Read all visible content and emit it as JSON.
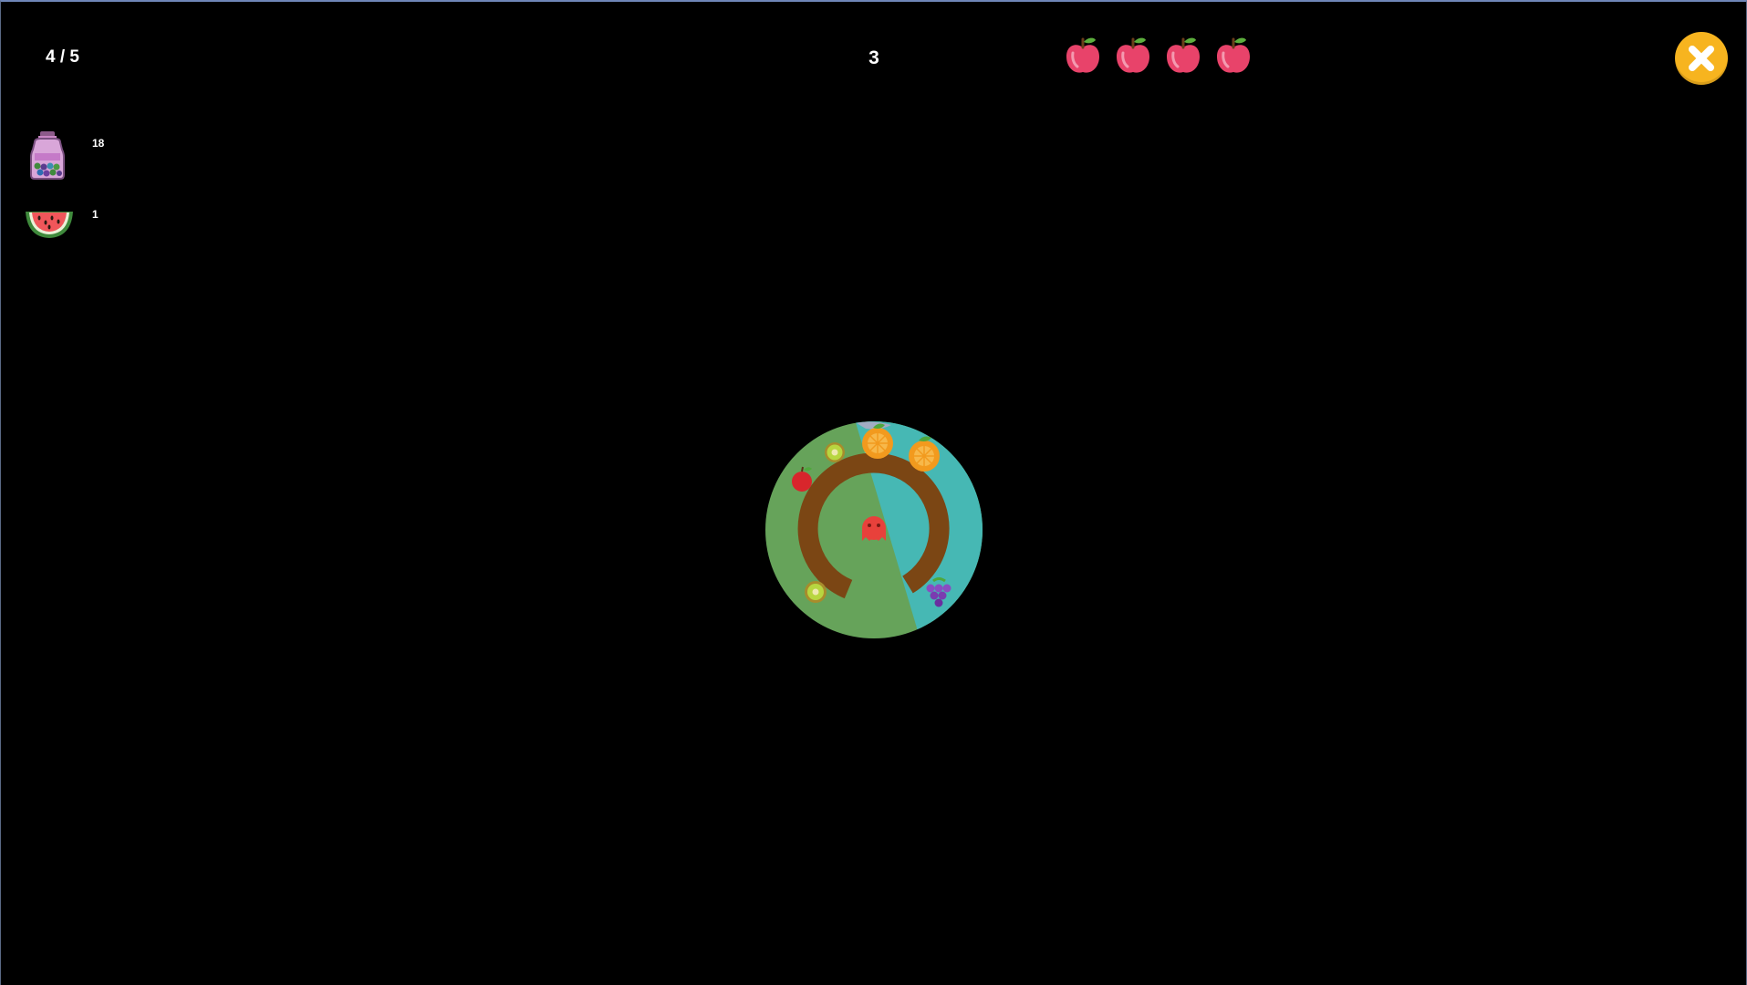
{
  "hud": {
    "level_progress": "4 / 5",
    "score": "3",
    "lives": 4,
    "close_icon": "close-x-icon"
  },
  "inventory": {
    "items": [
      {
        "icon": "berry-jar-icon",
        "count": "18"
      },
      {
        "icon": "watermelon-slice-icon",
        "count": "1"
      }
    ]
  },
  "world": {
    "colors": {
      "grass": "#66a35a",
      "water": "#46b8b4",
      "path": "#7b4614",
      "player": "#e8413b",
      "close_button": "#f7b41f",
      "life_apple": "#e8436a"
    },
    "fruits": [
      "orange",
      "orange",
      "kiwi",
      "apple",
      "kiwi",
      "grapes"
    ],
    "player": "red-blob-character"
  }
}
